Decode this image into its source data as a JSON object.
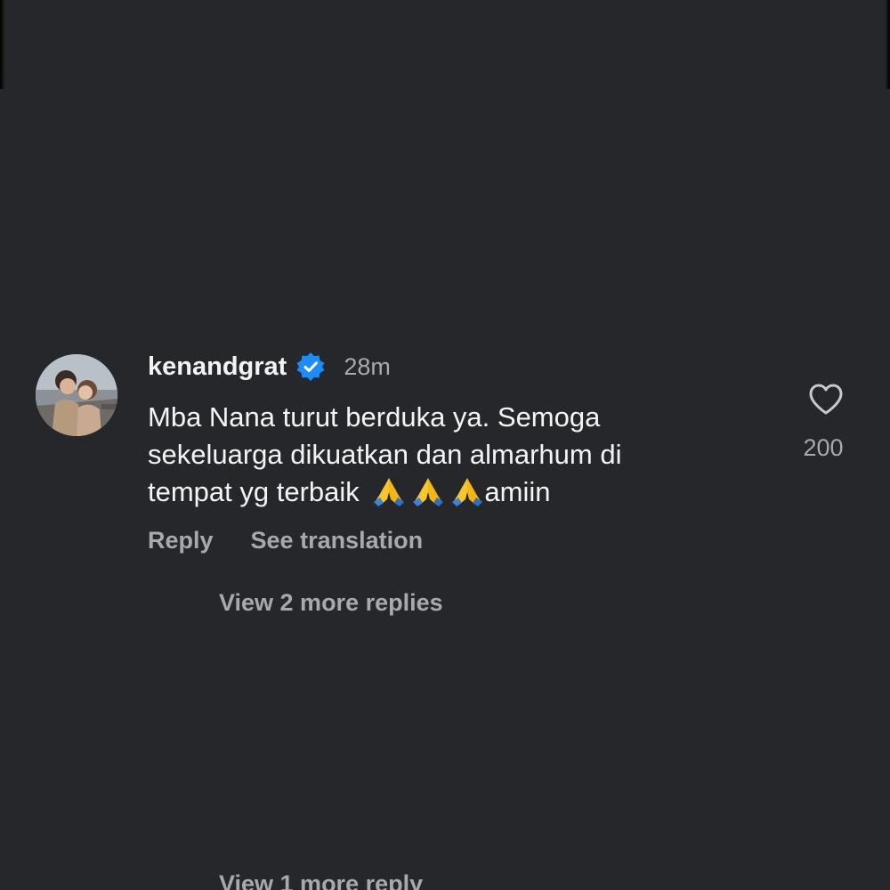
{
  "comment": {
    "username": "kenandgrat",
    "time": "28m",
    "text_line1": "Mba Nana turut berduka ya. Semoga",
    "text_line2": "sekeluarga dikuatkan dan almarhum di",
    "text_line3_start": "tempat yg terbaik ",
    "text_line3_end": "amiin",
    "reply_label": "Reply",
    "translate_label": "See translation",
    "like_count": "200",
    "view_more": "View 2 more replies"
  },
  "bottom": {
    "view_more": "View 1 more reply"
  },
  "icons": {
    "verified": "verified-badge-icon",
    "like": "heart-outline-icon",
    "emoji": "folded-hands-emoji"
  },
  "colors": {
    "background": "#25272b",
    "verified": "#1d8cf8",
    "secondary_text": "#a8a9ad",
    "primary_text": "#f4f4f4"
  }
}
